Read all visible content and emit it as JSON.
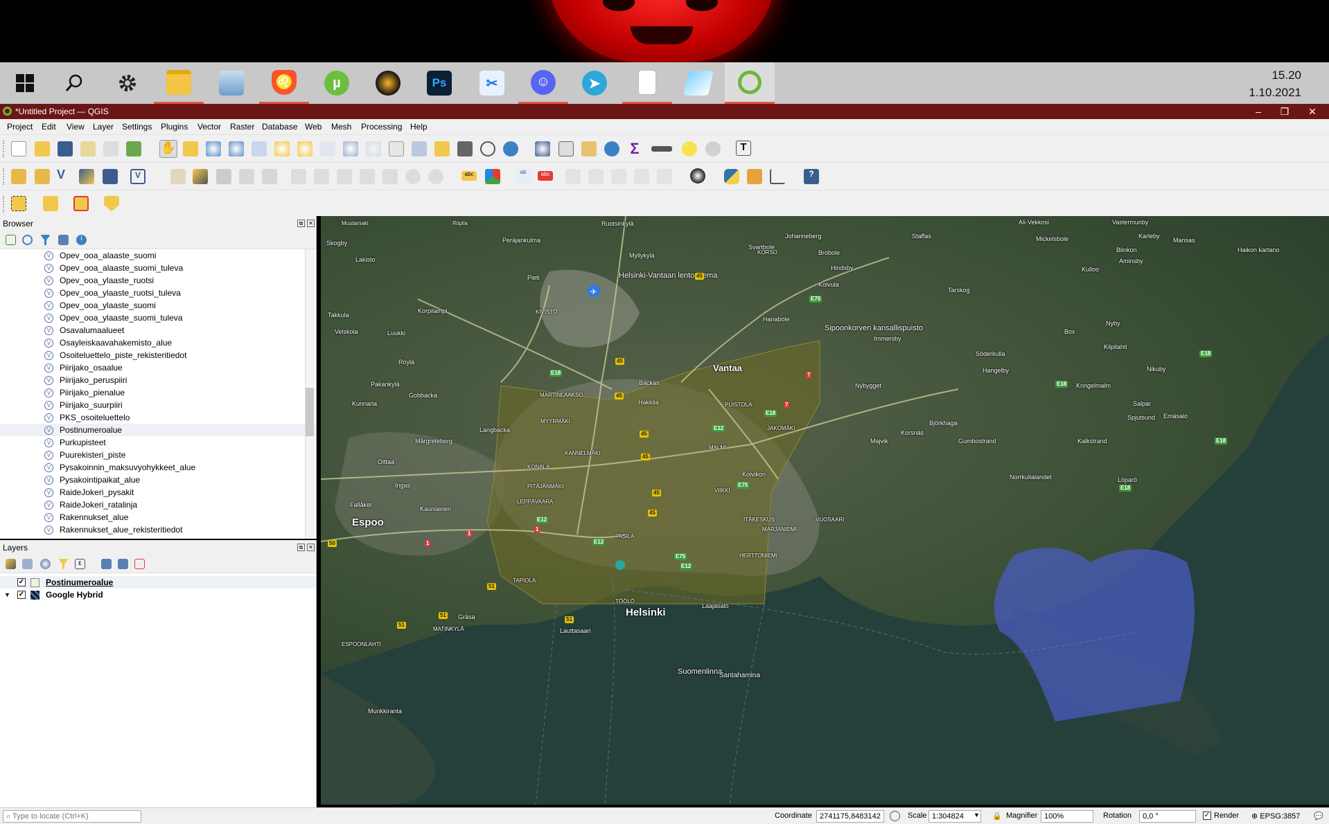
{
  "taskbar": {
    "clock_time": "15.20",
    "clock_date": "1.10.2021",
    "items": [
      "windows-start",
      "search",
      "settings",
      "file-explorer",
      "photos",
      "brave",
      "utorrent",
      "fl-studio",
      "photoshop",
      "davinci",
      "discord",
      "telegram",
      "notepad",
      "paint",
      "qgis"
    ]
  },
  "window": {
    "title": "*Untitled Project — QGIS",
    "min": "–",
    "max": "❐",
    "close": "✕"
  },
  "menu": [
    "Project",
    "Edit",
    "View",
    "Layer",
    "Settings",
    "Plugins",
    "Vector",
    "Raster",
    "Database",
    "Web",
    "Mesh",
    "Processing",
    "Help"
  ],
  "browser": {
    "title": "Browser",
    "items": [
      "Opev_ooa_alaaste_suomi",
      "Opev_ooa_alaaste_suomi_tuleva",
      "Opev_ooa_ylaaste_ruotsi",
      "Opev_ooa_ylaaste_ruotsi_tuleva",
      "Opev_ooa_ylaaste_suomi",
      "Opev_ooa_ylaaste_suomi_tuleva",
      "Osavalumaalueet",
      "Osayleiskaavahakemisto_alue",
      "Osoiteluettelo_piste_rekisteritiedot",
      "Piirijako_osaalue",
      "Piirijako_peruspiiri",
      "Piirijako_pienalue",
      "Piirijako_suurpiiri",
      "PKS_osoiteluettelo",
      "Postinumeroalue",
      "Purkupisteet",
      "Puurekisteri_piste",
      "Pysakoinnin_maksuvyohykkeet_alue",
      "Pysakointipaikat_alue",
      "RaideJokeri_pysakit",
      "RaideJokeri_ratalinja",
      "Rakennukset_alue",
      "Rakennukset_alue_rekisteritiedot"
    ],
    "selected_index": 14
  },
  "layers": {
    "title": "Layers",
    "items": [
      {
        "name": "Postinumeroalue",
        "checked": "✓",
        "color": "#f0f0e0"
      },
      {
        "name": "Google Hybrid",
        "checked": "✓",
        "color": "#3a6ea5"
      }
    ]
  },
  "map": {
    "places": [
      {
        "t": "Mustamaki"
      },
      {
        "t": "Riipila"
      },
      {
        "t": "Ruotsinkylä"
      },
      {
        "t": "Johanneberg"
      },
      {
        "t": "Staffas"
      },
      {
        "t": "Ali-Vekkosi"
      },
      {
        "t": "Vastermunby"
      },
      {
        "t": "Skogby"
      },
      {
        "t": "Peräjankulma"
      },
      {
        "t": "Svartbole"
      },
      {
        "t": "Mickelsbole"
      },
      {
        "t": "Karleby"
      },
      {
        "t": "Mansas"
      },
      {
        "t": "Brobole"
      },
      {
        "t": "Blinkon"
      },
      {
        "t": "Haikon kartano"
      },
      {
        "t": "Lakisto"
      },
      {
        "t": "Myllykylä"
      },
      {
        "t": "KORSO"
      },
      {
        "t": "Aminsby"
      },
      {
        "t": "Helsinki-Vantaan lentoasema"
      },
      {
        "t": "Hindsby"
      },
      {
        "t": "Kulloo"
      },
      {
        "t": "Pieti"
      },
      {
        "t": "Koivula"
      },
      {
        "t": "Tarskog"
      },
      {
        "t": "Takkula"
      },
      {
        "t": "Korpilampi"
      },
      {
        "t": "KIVISTÖ"
      },
      {
        "t": "Hanabole"
      },
      {
        "t": "Sipoonkorven kansallispuisto"
      },
      {
        "t": "Box"
      },
      {
        "t": "Nyby"
      },
      {
        "t": "Velskola"
      },
      {
        "t": "Luukki"
      },
      {
        "t": "Immersby"
      },
      {
        "t": "Kilpilahti"
      },
      {
        "t": "Söderkulla"
      },
      {
        "t": "Röylä"
      },
      {
        "t": "Vantaa"
      },
      {
        "t": "Hangelby"
      },
      {
        "t": "Nikuby"
      },
      {
        "t": "Pakankylä"
      },
      {
        "t": "Nybygget"
      },
      {
        "t": "Backas"
      },
      {
        "t": "Kringelmalm"
      },
      {
        "t": "Gobbacka"
      },
      {
        "t": "MARTINLAAKSO"
      },
      {
        "t": "Kunnarla"
      },
      {
        "t": "Hakkila"
      },
      {
        "t": "PUISTOLA"
      },
      {
        "t": "Salpar"
      },
      {
        "t": "MYYRMÄKI"
      },
      {
        "t": "Björkhaga"
      },
      {
        "t": "Spjutsund"
      },
      {
        "t": "Emäsalo"
      },
      {
        "t": "Langbacka"
      },
      {
        "t": "JAKOMÄKI"
      },
      {
        "t": "Korsnäs"
      },
      {
        "t": "Mårgreteberg"
      },
      {
        "t": "Majvik"
      },
      {
        "t": "Gumbostrand"
      },
      {
        "t": "Kalkstrand"
      },
      {
        "t": "MALMI"
      },
      {
        "t": "Oittaa"
      },
      {
        "t": "KANNELMÄKI"
      },
      {
        "t": "KONALA"
      },
      {
        "t": "Norrkullalandet"
      },
      {
        "t": "Koivikon"
      },
      {
        "t": "Löparö"
      },
      {
        "t": "Ingas"
      },
      {
        "t": "PITÄJÄNMÄKI"
      },
      {
        "t": "VIIKKI"
      },
      {
        "t": "Fallåker"
      },
      {
        "t": "Kauniainen"
      },
      {
        "t": "LEPPÄVAARA"
      },
      {
        "t": "ITÄKESKUS"
      },
      {
        "t": "VUOSAARI"
      },
      {
        "t": "Espoo"
      },
      {
        "t": "MARJANIEMI"
      },
      {
        "t": "PASILA"
      },
      {
        "t": "HERTTONIEMI"
      },
      {
        "t": "TAPIOLA"
      },
      {
        "t": "TÖÖLÖ"
      },
      {
        "t": "Laajasalo"
      },
      {
        "t": "Helsinki"
      },
      {
        "t": "Gräsa"
      },
      {
        "t": "MATINKYLÄ"
      },
      {
        "t": "Lauttasaari"
      },
      {
        "t": "ESPOONLAHTI"
      },
      {
        "t": "Suomenlinna"
      },
      {
        "t": "Santahamina"
      },
      {
        "t": "Munkkiranta"
      }
    ],
    "roads": [
      "45",
      "45",
      "E75",
      "E18",
      "E18",
      "E18",
      "E18",
      "E18",
      "45",
      "E12",
      "E12",
      "45",
      "E75",
      "E18",
      "50",
      "1",
      "1",
      "51",
      "51",
      "E75",
      "E12",
      "E12",
      "51",
      "51",
      "1",
      "7",
      "45",
      "45",
      "45",
      "7"
    ]
  },
  "status": {
    "locate_placeholder": "Type to locate (Ctrl+K)",
    "coord_label": "Coordinate",
    "coord_value": "2741175,8483142",
    "scale_label": "Scale",
    "scale_value": "1:304824",
    "magnifier_label": "Magnifier",
    "magnifier_value": "100%",
    "rotation_label": "Rotation",
    "rotation_value": "0,0 °",
    "render_label": "Render",
    "epsg": "EPSG:3857"
  }
}
